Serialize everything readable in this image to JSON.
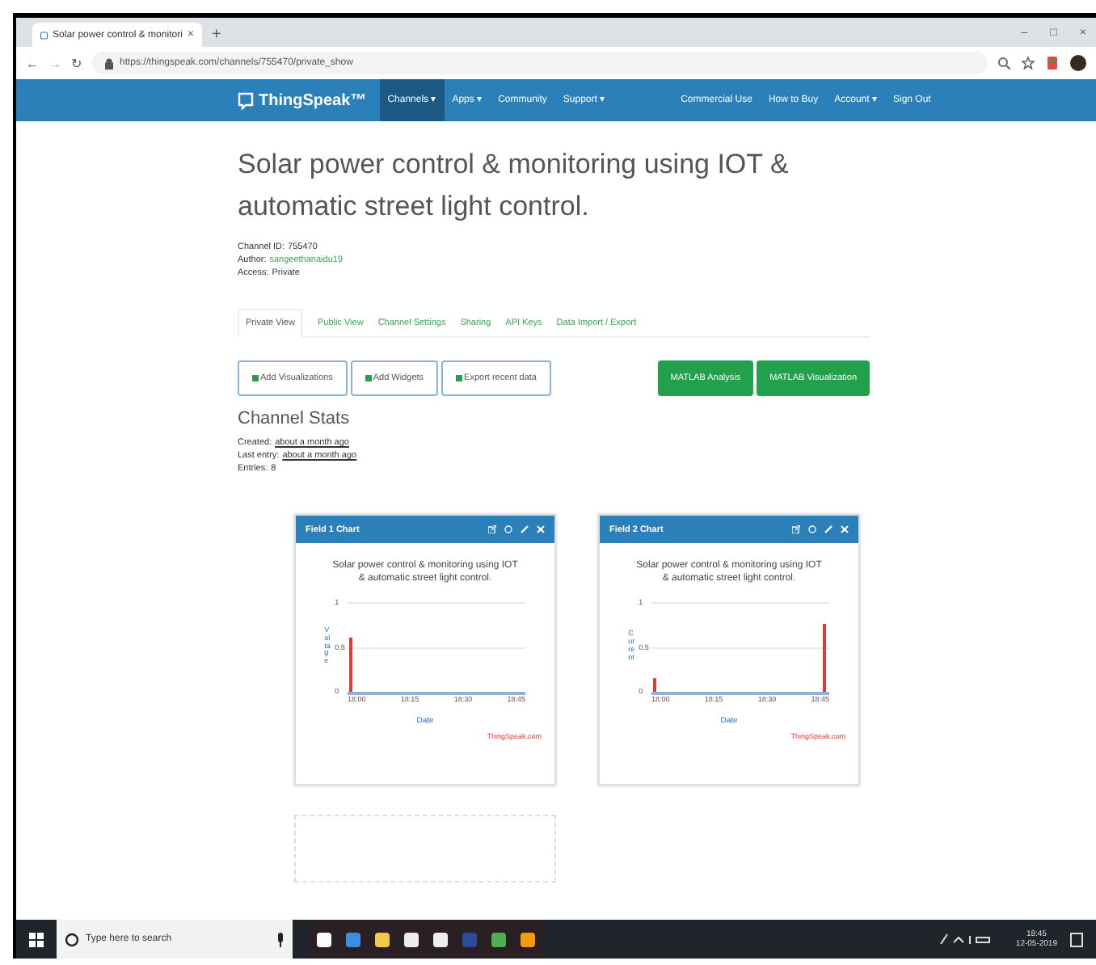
{
  "browser": {
    "nav_buttons": [
      "←",
      "→",
      "↻"
    ],
    "tab_title": "Solar power control & monitori",
    "tab_close": "×",
    "new_tab": "+",
    "url": "https://thingspeak.com/channels/755470/private_show",
    "window_controls": [
      "–",
      "□",
      "×"
    ]
  },
  "navbar": {
    "logo": "ThingSpeak™",
    "items": [
      {
        "label": "Channels ▾",
        "selected": true
      },
      {
        "label": "Apps ▾",
        "selected": false
      },
      {
        "label": "Community",
        "selected": false
      },
      {
        "label": "Support ▾",
        "selected": false
      }
    ],
    "right_items": [
      "Commercial Use",
      "How to Buy",
      "Account ▾",
      "Sign Out"
    ]
  },
  "channel": {
    "title": "Solar power control & monitoring using IOT & automatic street light control.",
    "meta": [
      {
        "label": "Channel ID:",
        "value": "755470"
      },
      {
        "label": "Author:",
        "value": "sangeethanaidu19"
      },
      {
        "label": "Access:",
        "value": "Private"
      }
    ]
  },
  "tabs": [
    {
      "label": "Private View",
      "selected": true
    },
    {
      "label": "Public View",
      "selected": false
    },
    {
      "label": "Channel Settings",
      "selected": false
    },
    {
      "label": "Sharing",
      "selected": false
    },
    {
      "label": "API Keys",
      "selected": false
    },
    {
      "label": "Data Import / Export",
      "selected": false
    }
  ],
  "actions": [
    "Add Visualizations",
    "Add Widgets",
    "Export recent data"
  ],
  "matlab_buttons": [
    "MATLAB Analysis",
    "MATLAB Visualization"
  ],
  "stats": {
    "heading": "Channel Stats",
    "lines": [
      {
        "label": "Created:",
        "value": "about a month ago"
      },
      {
        "label": "Last entry:",
        "value": "about a month ago"
      },
      {
        "label": "Entries:",
        "value": "8"
      }
    ]
  },
  "charts": [
    {
      "header": "Field 1 Chart",
      "chart_data": {
        "type": "bar",
        "title": "Solar power control & monitoring using IOT & automatic street light control.",
        "xlabel": "Date",
        "ylabel": "Voltage",
        "categories": [
          "18:00",
          "18:15",
          "18:30",
          "18:45"
        ],
        "series": [
          {
            "color": "#e53935",
            "values": [
              0.6,
              null,
              null,
              null
            ]
          }
        ],
        "ylim": [
          0,
          1
        ],
        "yticks": [
          0,
          0.5,
          1
        ]
      },
      "credit": "ThingSpeak.com"
    },
    {
      "header": "Field 2 Chart",
      "chart_data": {
        "type": "bar",
        "title": "Solar power control & monitoring using IOT & automatic street light control.",
        "xlabel": "Date",
        "ylabel": "Current",
        "categories": [
          "18:00",
          "18:15",
          "18:30",
          "18:45"
        ],
        "series": [
          {
            "color": "#e53935",
            "values": [
              0.15,
              null,
              null,
              0.75
            ]
          }
        ],
        "ylim": [
          0,
          1
        ],
        "yticks": [
          0,
          0.5,
          1
        ]
      },
      "credit": "ThingSpeak.com"
    }
  ],
  "taskbar": {
    "search_placeholder": "Type here to search",
    "time": "18:45",
    "date": "12-05-2019"
  }
}
